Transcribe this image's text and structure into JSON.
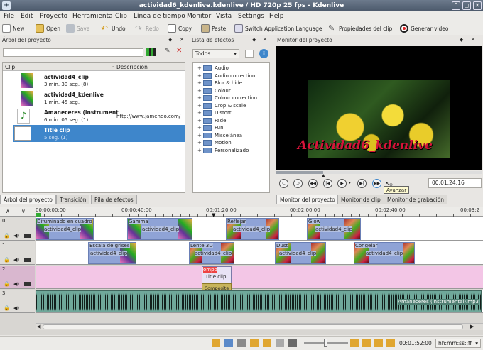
{
  "window": {
    "title": "actividad6_kdenlive.kdenlive / HD 720p 25 fps - Kdenlive"
  },
  "menu": [
    "File",
    "Edit",
    "Proyecto",
    "Herramienta",
    "Clip",
    "Línea de tiempo",
    "Monitor",
    "Vista",
    "Settings",
    "Help"
  ],
  "toolbar": {
    "new": "New",
    "open": "Open",
    "save": "Save",
    "undo": "Undo",
    "redo": "Redo",
    "copy": "Copy",
    "paste": "Paste",
    "switch_lang": "Switch Application Language",
    "clip_props": "Propiedades del clip",
    "record": "Generar vídeo"
  },
  "project_tree": {
    "title": "Árbol del proyecto",
    "col_clip": "Clip",
    "col_desc": "Descripción",
    "items": [
      {
        "name": "actividad4_clip",
        "meta": "3 min. 30 seg. (8)",
        "desc": ""
      },
      {
        "name": "actividad4_kdenlive",
        "meta": "1 min. 45 seg.",
        "desc": ""
      },
      {
        "name": "Amaneceres (instrument",
        "meta": "6 min. 05 seg. (1)",
        "desc": "http://www.jamendo.com/"
      },
      {
        "name": "Title clip",
        "meta": "5 seg. (1)",
        "desc": ""
      }
    ],
    "tabs": [
      "Árbol del proyecto",
      "Transición",
      "Pila de efectos"
    ]
  },
  "effects": {
    "title": "Lista de efectos",
    "filter": "Todos",
    "items": [
      "Audio",
      "Audio correction",
      "Blur & hide",
      "Colour",
      "Colour correction",
      "Crop & scale",
      "Distort",
      "Fade",
      "Fun",
      "Misceláneа",
      "Motion",
      "Personalizado"
    ]
  },
  "monitor": {
    "title": "Monitor del proyecto",
    "overlay_text": "Actividad6_kdenlive",
    "timecode": "00:01:24:16",
    "tooltip": "Avanzar",
    "tabs": [
      "Monitor del proyecto",
      "Monitor de clip",
      "Monitor de grabación"
    ]
  },
  "timeline": {
    "ruler": [
      "00:00:00:00",
      "00:00:40:00",
      "00:01:20:00",
      "00:02:00:00",
      "00:02:40:00",
      "00:03:2"
    ],
    "tracks": [
      "0",
      "1",
      "2",
      "3"
    ],
    "track0": [
      {
        "effect": "Difuminado en cuadro",
        "name": "actividad4_clip"
      },
      {
        "effect": "Gamma",
        "name": "actividad4_clip"
      },
      {
        "effect": "Reflejar",
        "name": "actividad4_clip"
      },
      {
        "effect": "Glow",
        "name": "actividad4_clip"
      }
    ],
    "track1": [
      {
        "effect": "Escala de grises",
        "name": "actividad4_clip"
      },
      {
        "effect": "Lente 3D",
        "name": "actividad4_clip"
      },
      {
        "effect": "Dust",
        "name": "actividad4_clip"
      },
      {
        "effect": "Congelar",
        "name": "actividad4_clip"
      }
    ],
    "track2": {
      "effect": "ompo",
      "name": "Title clip",
      "transition": "Composite"
    },
    "track3": {
      "name": "Amaneceres (instrumental).mp3"
    }
  },
  "status": {
    "timecode": "00:01:52:00",
    "format": "hh:mm:ss::ff"
  },
  "colors": {
    "accent": "#3e86cb",
    "video_clip": "#8fa3d6",
    "title_track": "#f3c6e6",
    "audio_clip": "#6fa89a"
  }
}
